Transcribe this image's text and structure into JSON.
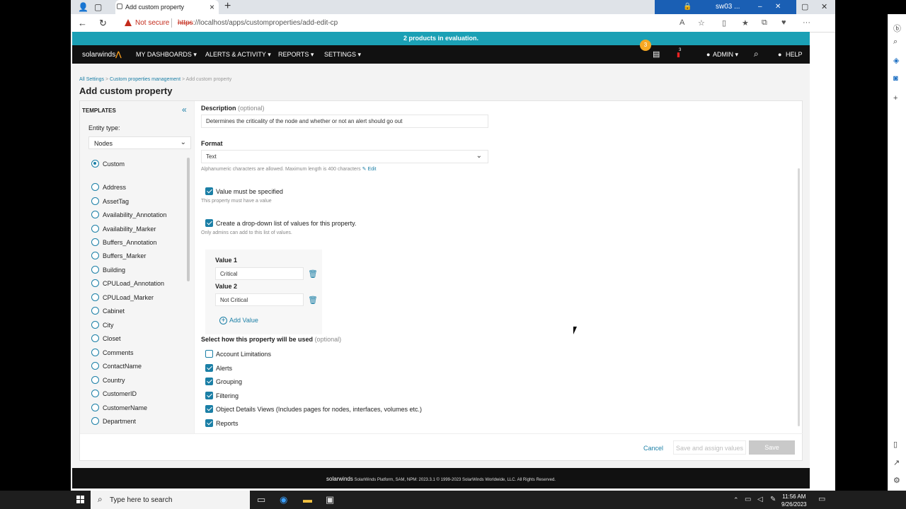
{
  "browser": {
    "tab_title": "Add custom property",
    "tab_close": "×",
    "new_tab": "+",
    "window_label": "sw03 ...",
    "not_secure": "Not secure",
    "url_scheme": "https",
    "url_rest": "://localhost/apps/customproperties/add-edit-cp"
  },
  "app": {
    "eval_banner": "2 products in evaluation.",
    "logo": "solarwinds",
    "nav": {
      "dashboards": "MY DASHBOARDS ▾",
      "alerts": "ALERTS & ACTIVITY ▾",
      "reports": "REPORTS ▾",
      "settings": "SETTINGS ▾",
      "admin": "ADMIN ▾",
      "help": "HELP",
      "notif_count": "3",
      "alert_count": "3"
    },
    "breadcrumb": {
      "all_settings": "All Settings",
      "cpm": "Custom properties management",
      "current": "Add custom property",
      "sep": ">"
    },
    "page_title": "Add custom property"
  },
  "templates": {
    "title": "TEMPLATES",
    "collapse": "«",
    "entity_label": "Entity type:",
    "entity_value": "Nodes",
    "items": [
      "Custom",
      "Address",
      "AssetTag",
      "Availability_Annotation",
      "Availability_Marker",
      "Buffers_Annotation",
      "Buffers_Marker",
      "Building",
      "CPULoad_Annotation",
      "CPULoad_Marker",
      "Cabinet",
      "City",
      "Closet",
      "Comments",
      "ContactName",
      "Country",
      "CustomerID",
      "CustomerName",
      "Department"
    ]
  },
  "form": {
    "description_label": "Description",
    "optional": "(optional)",
    "description_value": "Determines the criticality of the node and whether or not an alert should go out",
    "format_label": "Format",
    "format_value": "Text",
    "format_hint": "Alphanumeric characters are allowed. Maximum length is 400 characters",
    "edit_link": "Edit",
    "required_label": "Value must be specified",
    "required_hint": "This property must have a value",
    "dropdown_label": "Create a drop-down list of values for this property.",
    "dropdown_hint": "Only admins can add to this list of values.",
    "value1_label": "Value 1",
    "value1": "Critical",
    "value2_label": "Value 2",
    "value2": "Not Critical",
    "add_value": "Add Value",
    "usage_label": "Select how this property will be used",
    "usage": [
      {
        "label": "Account Limitations",
        "checked": false
      },
      {
        "label": "Alerts",
        "checked": true
      },
      {
        "label": "Grouping",
        "checked": true
      },
      {
        "label": "Filtering",
        "checked": true
      },
      {
        "label": "Object Details Views (Includes pages for nodes, interfaces, volumes etc.)",
        "checked": true
      },
      {
        "label": "Reports",
        "checked": true
      }
    ],
    "cancel": "Cancel",
    "save_assign": "Save and assign values",
    "save": "Save"
  },
  "footer": {
    "logo": "solarwinds",
    "text": "SolarWinds Platform, SAM, NPM: 2023.3.1 © 1999-2023 SolarWinds Worldwide, LLC. All Rights Reserved."
  },
  "taskbar": {
    "search_placeholder": "Type here to search",
    "time": "11:56 AM",
    "date": "9/26/2023"
  }
}
